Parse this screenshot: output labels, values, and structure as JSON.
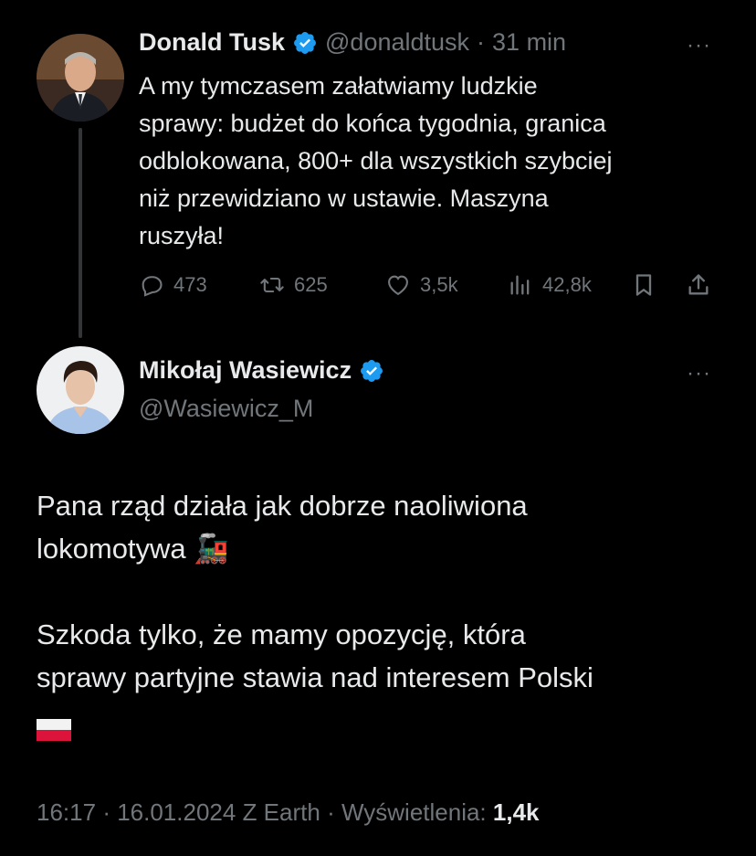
{
  "parent": {
    "name": "Donald Tusk",
    "handle": "@donaldtusk",
    "sep": "·",
    "time": "31 min",
    "more": "···",
    "text_lines": [
      "A my tymczasem załatwiamy ludzkie",
      "sprawy: budżet do końca tygodnia, granica",
      "odblokowana, 800+ dla wszystkich szybciej",
      "niż przewidziano w ustawie. Maszyna",
      "ruszyła!"
    ],
    "stats": {
      "replies": "473",
      "reposts": "625",
      "likes": "3,5k",
      "views": "42,8k"
    }
  },
  "reply": {
    "name": "Mikołaj Wasiewicz",
    "handle": "@Wasiewicz_M",
    "more": "···",
    "para1_line1": "Pana rząd działa jak dobrze naoliwiona",
    "para1_line2": "lokomotywa",
    "para1_emoji": "🚂",
    "para2_line1": "Szkoda tylko, że mamy opozycję, która",
    "para2_line2": "sprawy partyjne stawia nad interesem Polski",
    "para2_emoji": "🇵🇱",
    "footer": {
      "time": "16:17",
      "date": "16.01.2024",
      "source": "Z Earth",
      "views_label": "Wyświetlenia:",
      "views": "1,4k"
    }
  },
  "colors": {
    "verified": "#1d9bf0",
    "muted": "#71767b",
    "text": "#e7e9ea",
    "background": "#000000"
  }
}
